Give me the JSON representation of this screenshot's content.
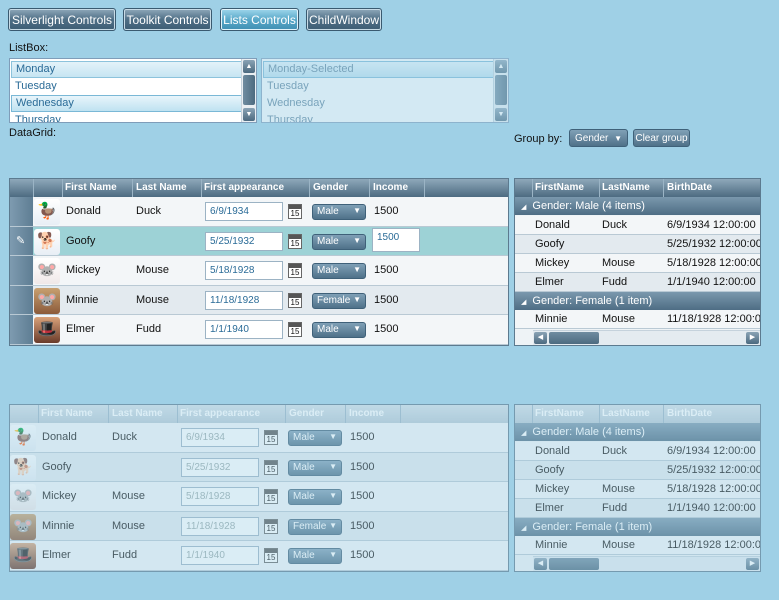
{
  "top_buttons": [
    "Silverlight Controls",
    "Toolkit Controls",
    "Lists Controls",
    "ChildWindow"
  ],
  "listbox_label": "ListBox:",
  "listbox1": [
    "Monday",
    "Tuesday",
    "Wednesday",
    "Thursday"
  ],
  "listbox2": [
    "Monday-Selected",
    "Tuesday",
    "Wednesday",
    "Thursday"
  ],
  "datagrid_label": "DataGrid:",
  "group_by_label": "Group by:",
  "group_by_value": "Gender",
  "clear_group": "Clear group",
  "grid_columns": [
    "First Name",
    "Last Name",
    "First appearance",
    "Gender",
    "Income"
  ],
  "grid_rows": [
    {
      "first": "Donald",
      "last": "Duck",
      "date": "6/9/1934",
      "gender": "Male",
      "income": "1500"
    },
    {
      "first": "Goofy",
      "last": "",
      "date": "5/25/1932",
      "gender": "Male",
      "income": "1500"
    },
    {
      "first": "Mickey",
      "last": "Mouse",
      "date": "5/18/1928",
      "gender": "Male",
      "income": "1500"
    },
    {
      "first": "Minnie",
      "last": "Mouse",
      "date": "11/18/1928",
      "gender": "Female",
      "income": "1500"
    },
    {
      "first": "Elmer",
      "last": "Fudd",
      "date": "1/1/1940",
      "gender": "Male",
      "income": "1500"
    }
  ],
  "calendar_glyph": "15",
  "group_columns": [
    "FirstName",
    "LastName",
    "BirthDate"
  ],
  "group_headers": [
    "Gender: Male (4 items)",
    "Gender: Female (1 item)"
  ],
  "group_rows": [
    {
      "first": "Donald",
      "last": "Duck",
      "birth": "6/9/1934 12:00:00"
    },
    {
      "first": "Goofy",
      "last": "",
      "birth": "5/25/1932 12:00:00"
    },
    {
      "first": "Mickey",
      "last": "Mouse",
      "birth": "5/18/1928 12:00:00"
    },
    {
      "first": "Elmer",
      "last": "Fudd",
      "birth": "1/1/1940 12:00:00"
    },
    {
      "first": "Minnie",
      "last": "Mouse",
      "birth": "11/18/1928 12:00:00"
    }
  ]
}
